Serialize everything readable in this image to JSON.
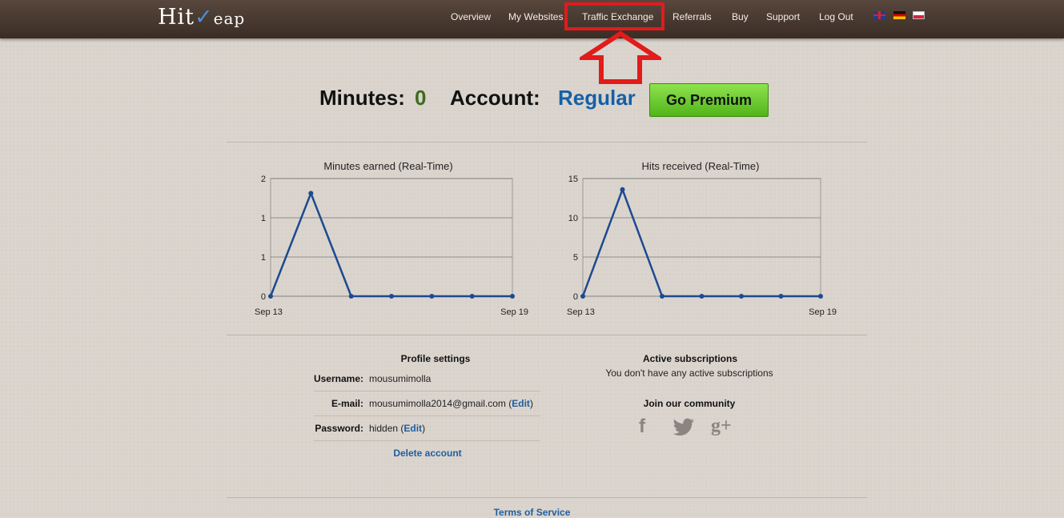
{
  "brand": {
    "name_first": "Hit",
    "name_rest": "eap"
  },
  "nav": {
    "items": [
      "Overview",
      "My Websites",
      "Traffic Exchange",
      "Referrals",
      "Buy",
      "Support",
      "Log Out"
    ],
    "flags": [
      "uk-flag",
      "germany-flag",
      "poland-flag"
    ]
  },
  "stats": {
    "minutes_label": "Minutes:",
    "minutes_value": "0",
    "account_label": "Account:",
    "account_value": "Regular",
    "premium_button": "Go Premium"
  },
  "chart_data": [
    {
      "type": "line",
      "title": "Minutes earned (Real-Time)",
      "x": [
        "Sep 13",
        "Sep 14",
        "Sep 15",
        "Sep 16",
        "Sep 17",
        "Sep 18",
        "Sep 19"
      ],
      "values": [
        0,
        1.75,
        0,
        0,
        0,
        0,
        0
      ],
      "y_ticks": [
        "0",
        "1",
        "1",
        "2"
      ],
      "ylim": [
        0,
        2
      ],
      "x_tick_labels": [
        "Sep 13",
        "Sep 19"
      ],
      "grid": true,
      "line_color": "#1d4a8f"
    },
    {
      "type": "line",
      "title": "Hits received (Real-Time)",
      "x": [
        "Sep 13",
        "Sep 14",
        "Sep 15",
        "Sep 16",
        "Sep 17",
        "Sep 18",
        "Sep 19"
      ],
      "values": [
        0,
        13.6,
        0,
        0,
        0,
        0,
        0
      ],
      "y_ticks": [
        "0",
        "5",
        "10",
        "15"
      ],
      "ylim": [
        0,
        15
      ],
      "x_tick_labels": [
        "Sep 13",
        "Sep 19"
      ],
      "grid": true,
      "line_color": "#1d4a8f"
    }
  ],
  "profile": {
    "title": "Profile settings",
    "username_label": "Username:",
    "username_value": "mousumimolla",
    "email_label": "E-mail:",
    "email_value": "mousumimolla2014@gmail.com",
    "password_label": "Password:",
    "password_value": "hidden",
    "edit_label": "Edit",
    "delete_label": "Delete account"
  },
  "subscriptions": {
    "title": "Active subscriptions",
    "message": "You don't have any active subscriptions"
  },
  "community": {
    "title": "Join our community",
    "icons": [
      "facebook-icon",
      "twitter-icon",
      "google-plus-icon"
    ]
  },
  "footer": {
    "terms_label": "Terms of Service"
  },
  "colors": {
    "accent": "#1560a8",
    "highlight": "#e21b1b",
    "premium": "#5cc020"
  }
}
